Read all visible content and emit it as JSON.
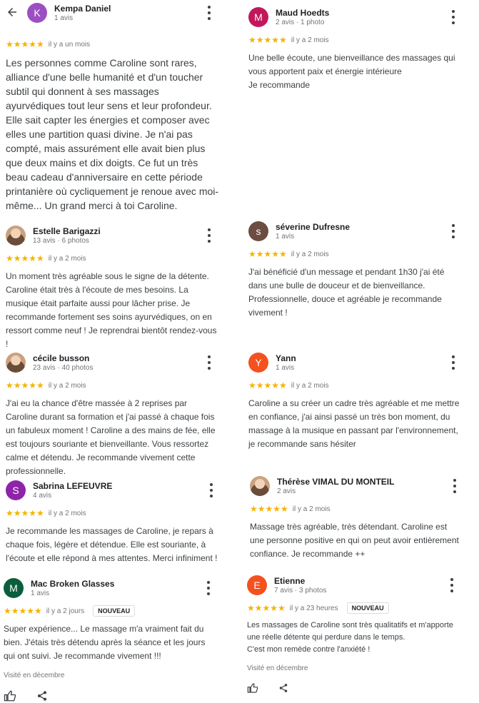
{
  "left": [
    {
      "name": "Kempa Daniel",
      "meta": "1 avis",
      "avatar_letter": "K",
      "avatar_color": "#9c4fc3",
      "stars": "★★★★★",
      "when": "il y a un mois",
      "text": "Les personnes comme Caroline sont rares, alliance d'une belle humanité et d'un toucher subtil qui donnent à ses massages ayurvédiques tout leur sens et leur profondeur. Elle sait capter les énergies et composer avec elles une partition quasi divine. Je n'ai pas compté, mais assurément elle avait bien plus que deux mains et dix doigts. Ce fut un très beau cadeau d'anniversaire en cette période printanière où cycliquement je renoue avec moi-même... Un grand merci à toi Caroline."
    },
    {
      "name": "Estelle Barigazzi",
      "meta": "13 avis · 6 photos",
      "avatar_letter": "",
      "avatar_color": "#c9a27e",
      "stars": "★★★★★",
      "when": "il y a 2 mois",
      "text": "Un moment très agréable sous le signe de la détente. Caroline était très à l'écoute de mes besoins. La musique était parfaite aussi pour lâcher prise. Je recommande fortement ses soins ayurvédiques, on en ressort comme neuf ! Je reprendrai bientôt rendez-vous !"
    },
    {
      "name": "cécile busson",
      "meta": "23 avis · 40 photos",
      "avatar_letter": "",
      "avatar_color": "#b08a6a",
      "stars": "★★★★★",
      "when": "il y a 2 mois",
      "text": "J'ai eu la chance d'être massée à 2 reprises par Caroline durant sa formation et j'ai passé à chaque fois un fabuleux moment ! Caroline a des mains de fée, elle est toujours souriante et bienveillante. Vous ressortez calme et détendu. Je recommande vivement cette professionnelle."
    },
    {
      "name": "Sabrina LEFEUVRE",
      "meta": "4 avis",
      "avatar_letter": "S",
      "avatar_color": "#8e24aa",
      "stars": "★★★★★",
      "when": "il y a 2 mois",
      "text": "Je recommande les massages de Caroline, je repars à chaque fois, légère et détendue. Elle est souriante, à l'écoute et elle répond à mes attentes. Merci infiniment !"
    },
    {
      "name": "Mac Broken Glasses",
      "meta": "1 avis",
      "avatar_letter": "M",
      "avatar_color": "#0b5e3c",
      "stars": "★★★★★",
      "when": "il y a 2 jours",
      "badge": "NOUVEAU",
      "text": "Super expérience... Le massage m'a vraiment fait du bien. J'étais très détendu après la séance et les jours qui ont suivi. Je recommande vivement !!!",
      "visited": "Visité en décembre"
    }
  ],
  "right": [
    {
      "name": "Maud Hoedts",
      "meta": "2 avis · 1 photo",
      "avatar_letter": "M",
      "avatar_color": "#c2185b",
      "stars": "★★★★★",
      "when": "il y a 2 mois",
      "text": "Une belle écoute, une bienveillance des massages qui vous apportent paix et énergie intérieure\nJe recommande"
    },
    {
      "name": "séverine Dufresne",
      "meta": "1 avis",
      "avatar_letter": "s",
      "avatar_color": "#6d4c41",
      "stars": "★★★★★",
      "when": "il y a 2 mois",
      "text": "J'ai bénéficié d'un message et pendant 1h30 j'ai été dans une bulle de douceur et de bienveillance. Professionnelle, douce et agréable je recommande vivement !"
    },
    {
      "name": "Yann",
      "meta": "1 avis",
      "avatar_letter": "Y",
      "avatar_color": "#f4511e",
      "stars": "★★★★★",
      "when": "il y a 2 mois",
      "text": "Caroline a su créer un cadre très agréable et me mettre en confiance, j'ai ainsi passé un très bon moment, du massage à la musique en passant par l'environnement, je recommande sans hésiter"
    },
    {
      "name": "Thérèse VIMAL DU MONTEIL",
      "meta": "2 avis",
      "avatar_letter": "",
      "avatar_color": "#a47c5e",
      "stars": "★★★★★",
      "when": "il y a 2 mois",
      "text": "Massage très agréable, très détendant. Caroline est une personne positive en qui on peut avoir entièrement confiance. Je recommande ++"
    },
    {
      "name": "Etienne",
      "meta": "7 avis · 3 photos",
      "avatar_letter": "E",
      "avatar_color": "#f4511e",
      "stars": "★★★★★",
      "when": "il y a 23 heures",
      "badge": "NOUVEAU",
      "text": "Les massages de Caroline sont très qualitatifs et m'apporte une réelle détente qui perdure dans le temps.\nC'est mon remède contre l'anxiété !",
      "visited": "Visité en décembre"
    }
  ]
}
